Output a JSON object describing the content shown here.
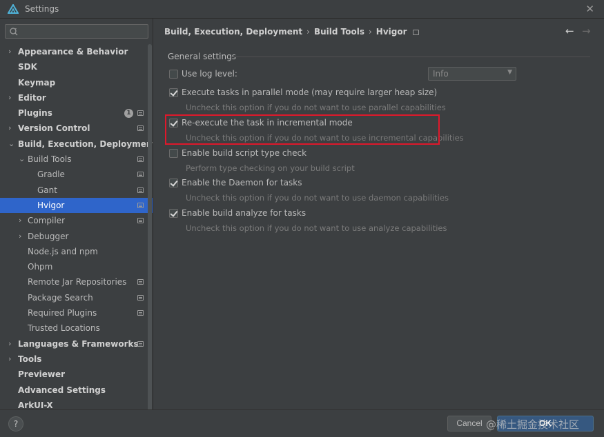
{
  "window": {
    "title": "Settings"
  },
  "search": {
    "placeholder": "",
    "value": ""
  },
  "sidebar": {
    "items": [
      {
        "label": "Appearance & Behavior",
        "chevron": ">",
        "bold": true
      },
      {
        "label": "SDK",
        "chevron": "",
        "bold": true
      },
      {
        "label": "Keymap",
        "chevron": "",
        "bold": true
      },
      {
        "label": "Editor",
        "chevron": ">",
        "bold": true
      },
      {
        "label": "Plugins",
        "chevron": "",
        "bold": true,
        "badge": "1"
      },
      {
        "label": "Version Control",
        "chevron": ">",
        "bold": true
      },
      {
        "label": "Build, Execution, Deployment",
        "chevron": "v",
        "bold": true
      },
      {
        "label": "Build Tools",
        "chevron": "v",
        "bold": false
      },
      {
        "label": "Gradle",
        "chevron": "",
        "bold": false
      },
      {
        "label": "Gant",
        "chevron": "",
        "bold": false
      },
      {
        "label": "Hvigor",
        "chevron": "",
        "bold": false,
        "selected": true
      },
      {
        "label": "Compiler",
        "chevron": ">",
        "bold": false
      },
      {
        "label": "Debugger",
        "chevron": ">",
        "bold": false
      },
      {
        "label": "Node.js and npm",
        "chevron": "",
        "bold": false
      },
      {
        "label": "Ohpm",
        "chevron": "",
        "bold": false
      },
      {
        "label": "Remote Jar Repositories",
        "chevron": "",
        "bold": false
      },
      {
        "label": "Package Search",
        "chevron": "",
        "bold": false
      },
      {
        "label": "Required Plugins",
        "chevron": "",
        "bold": false
      },
      {
        "label": "Trusted Locations",
        "chevron": "",
        "bold": false
      },
      {
        "label": "Languages & Frameworks",
        "chevron": ">",
        "bold": true
      },
      {
        "label": "Tools",
        "chevron": ">",
        "bold": true
      },
      {
        "label": "Previewer",
        "chevron": "",
        "bold": true
      },
      {
        "label": "Advanced Settings",
        "chevron": "",
        "bold": true
      },
      {
        "label": "ArkUI-X",
        "chevron": "",
        "bold": true
      }
    ]
  },
  "breadcrumb": {
    "part1": "Build, Execution, Deployment",
    "part2": "Build Tools",
    "part3": "Hvigor",
    "separator": "›"
  },
  "nav": {
    "back": "←",
    "forward": "→"
  },
  "main": {
    "group_title": "General settings",
    "log_level": {
      "label": "Use log level:",
      "checked": false,
      "dropdown_value": "Info"
    },
    "options": [
      {
        "label": "Execute tasks in parallel mode (may require larger heap size)",
        "hint": "Uncheck this option if you do not want to use parallel capabilities",
        "checked": true
      },
      {
        "label": "Re-execute the task in incremental mode",
        "hint": "Uncheck this option if you do not want to use incremental capabilities",
        "checked": true
      },
      {
        "label": "Enable build script type check",
        "hint": "Perform type checking on your build script",
        "checked": false
      },
      {
        "label": "Enable the Daemon for tasks",
        "hint": "Uncheck this option if you do not want to use daemon capabilities",
        "checked": true
      },
      {
        "label": "Enable build analyze for tasks",
        "hint": "Uncheck this option if you do not want to use analyze capabilities",
        "checked": true
      }
    ]
  },
  "footer": {
    "help": "?",
    "cancel": "Cancel",
    "ok": "OK",
    "watermark": "@稀土掘金技术社区"
  },
  "colors": {
    "selection": "#2f65ca",
    "highlight_box": "#e0182b",
    "ok_button": "#365880",
    "background": "#3c3f41"
  }
}
